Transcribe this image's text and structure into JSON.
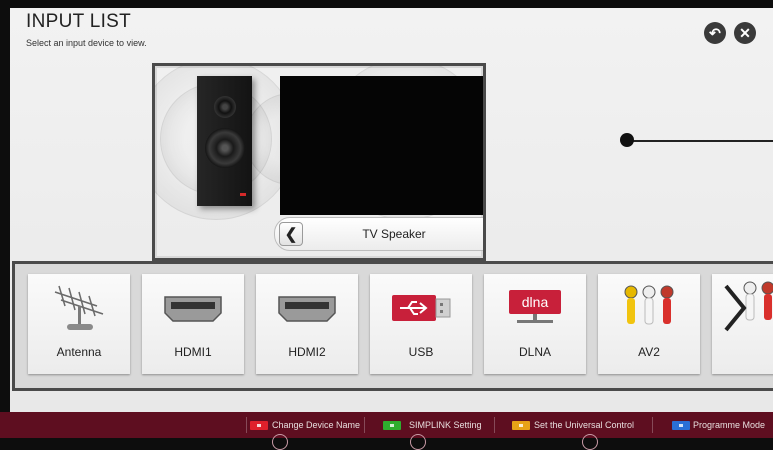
{
  "header": {
    "title": "INPUT LIST",
    "subtitle": "Select an input device to view."
  },
  "controls": {
    "back_icon": "back-icon",
    "close_icon": "close-icon"
  },
  "sound_output": {
    "current": "TV Speaker",
    "prev_icon": "chevron-left-icon",
    "next_icon": "chevron-right-icon"
  },
  "inputs": [
    {
      "label": "Antenna",
      "icon": "antenna-icon"
    },
    {
      "label": "HDMI1",
      "icon": "hdmi-icon"
    },
    {
      "label": "HDMI2",
      "icon": "hdmi-icon"
    },
    {
      "label": "USB",
      "icon": "usb-icon"
    },
    {
      "label": "DLNA",
      "icon": "dlna-icon",
      "badge": "dlna"
    },
    {
      "label": "AV2",
      "icon": "av-icon"
    }
  ],
  "footer": {
    "hints": [
      {
        "label": "Change Device Name",
        "color": "#e0202b"
      },
      {
        "label": "SIMPLINK Setting",
        "color": "#2eae2e"
      },
      {
        "label": "Set the Universal Control",
        "color": "#e8a317"
      },
      {
        "label": "Programme Mode",
        "color": "#2a6fd6"
      }
    ]
  }
}
